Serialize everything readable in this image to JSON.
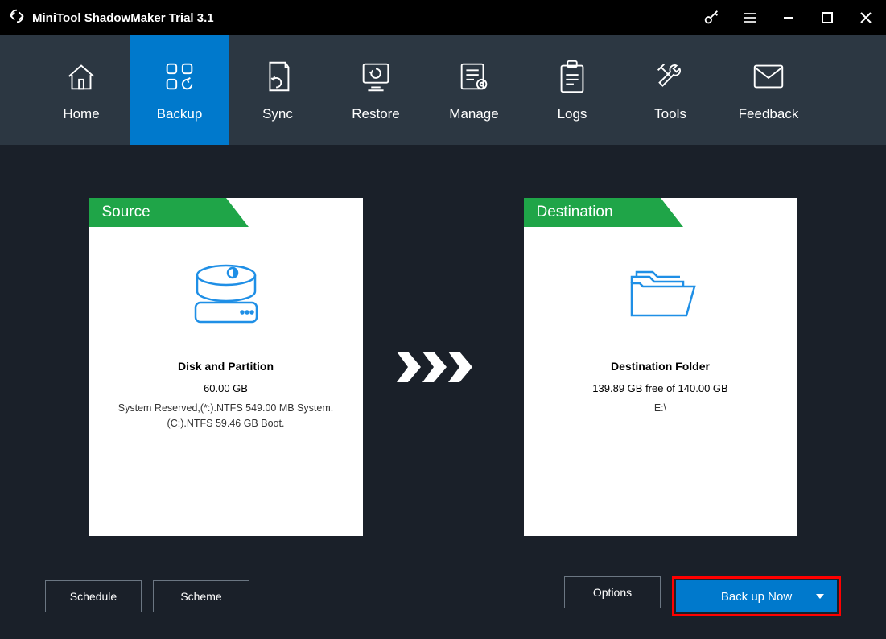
{
  "titlebar": {
    "app_title": "MiniTool ShadowMaker Trial 3.1"
  },
  "nav": {
    "items": [
      {
        "label": "Home"
      },
      {
        "label": "Backup",
        "active": true
      },
      {
        "label": "Sync"
      },
      {
        "label": "Restore"
      },
      {
        "label": "Manage"
      },
      {
        "label": "Logs"
      },
      {
        "label": "Tools"
      },
      {
        "label": "Feedback"
      }
    ]
  },
  "source_panel": {
    "tab": "Source",
    "heading": "Disk and Partition",
    "size": "60.00 GB",
    "details": "System Reserved,(*:).NTFS 549.00 MB System. (C:).NTFS 59.46 GB Boot."
  },
  "destination_panel": {
    "tab": "Destination",
    "heading": "Destination Folder",
    "free": "139.89 GB free of 140.00 GB",
    "path": "E:\\"
  },
  "footer": {
    "schedule": "Schedule",
    "scheme": "Scheme",
    "options": "Options",
    "backup_now": "Back up Now"
  }
}
